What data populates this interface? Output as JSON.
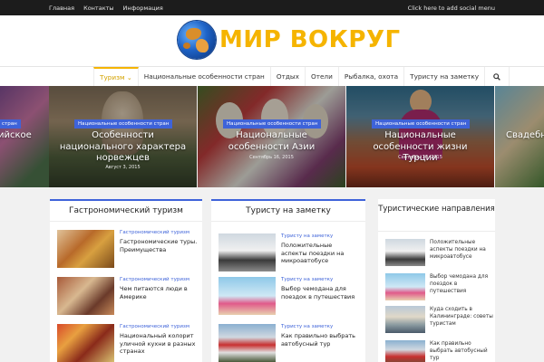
{
  "topbar": {
    "links": [
      "Главная",
      "Контакты",
      "Информация"
    ],
    "social": "Click here to add social menu"
  },
  "logo": {
    "text": "МИР ВОКРУГ"
  },
  "nav": {
    "items": [
      "Туризм",
      "Национальные особенности стран",
      "Отдых",
      "Отели",
      "Рыбалка, охота",
      "Туристу на заметку"
    ],
    "active_caret": "⌄",
    "search_icon": "search-icon"
  },
  "slider": [
    {
      "title": "ийское",
      "cat": "стран"
    },
    {
      "cat": "Национальные особенности стран",
      "title": "Особенности национального характера норвежцев",
      "date": "Август 3, 2015"
    },
    {
      "cat": "Национальные особенности стран",
      "title": "Национальные особенности Азии",
      "date": "Сентябрь 16, 2015"
    },
    {
      "cat": "Национальные особенности стран",
      "title": "Национальные особенности жизни Турции",
      "date": "Сентябрь 16, 2015"
    },
    {
      "title": "Свадебн"
    }
  ],
  "col1": {
    "title": "Гастрономический туризм",
    "items": [
      {
        "cat": "Гастрономический туризм",
        "title": "Гастрономические туры. Преимущества"
      },
      {
        "cat": "Гастрономический туризм",
        "title": "Чем питаются люди в Америке"
      },
      {
        "cat": "Гастрономический туризм",
        "title": "Национальный колорит уличной кухни в разных странах"
      }
    ]
  },
  "col2": {
    "title": "Туристу на заметку",
    "items": [
      {
        "cat": "Туристу на заметку",
        "title": "Положительные аспекты поездки на микроавтобусе"
      },
      {
        "cat": "Туристу на заметку",
        "title": "Выбор чемодана для поездок в путешествия"
      },
      {
        "cat": "Туристу на заметку",
        "title": "Как правильно выбрать автобусный тур"
      }
    ]
  },
  "side": {
    "title": "Туристические направления",
    "items": [
      "Положительные аспекты поездки на микроавтобусе",
      "Выбор чемодана для поездок в путешествия",
      "Куда сходить в Калининграде: советы туристам",
      "Как правильно выбрать автобусный тур"
    ]
  },
  "colors": {
    "accent": "#3e63d9",
    "logo": "#f5b400",
    "topbar": "#1c1c1c"
  }
}
